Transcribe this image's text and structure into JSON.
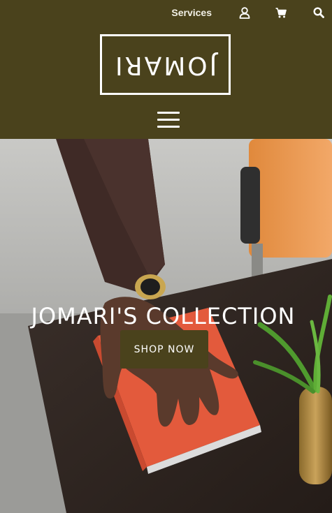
{
  "header": {
    "background": "#4a421c",
    "nav": {
      "services_label": "Services",
      "user_icon": "user-icon",
      "cart_icon": "cart-icon",
      "search_icon": "search-icon"
    },
    "logo_text": "JOMARI",
    "menu_icon": "hamburger-menu-icon"
  },
  "hero": {
    "title": "JOMARI'S COLLECTION",
    "cta_label": "SHOP NOW",
    "cta_color": "#4a421c"
  }
}
